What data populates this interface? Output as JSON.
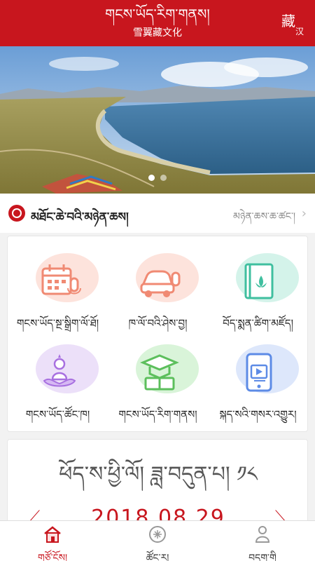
{
  "header": {
    "title_tibetan": "གངས་ཡོད་རིག་གནས།",
    "title_chinese": "雪翼藏文化",
    "lang_primary": "藏",
    "lang_secondary": "汉"
  },
  "banner": {
    "slide_count": 2,
    "active_index": 0
  },
  "news": {
    "title": "མཐོང་ཆེ་བའི་མཉེན་ཆས།",
    "more_label": "མཉེན་ཆས་ཆ་ཚང་།"
  },
  "grid": {
    "items": [
      {
        "label": "གངས་ཡོད་སྔ་སྒྲིག་ལོ་ཐོ།",
        "icon": "calendar-icon",
        "color": "#f5a38f"
      },
      {
        "label": "ཁ་ལོ་བའི་ཤེས་བྱ།",
        "icon": "car-icon",
        "color": "#f5a38f"
      },
      {
        "label": "བོད་སྨན་ཚིག་མཛོད།",
        "icon": "medicine-book-icon",
        "color": "#5fcfb5"
      },
      {
        "label": "གངས་ཡོད་ཚོང་ཁ།",
        "icon": "buddha-lotus-icon",
        "color": "#c39be8"
      },
      {
        "label": "གངས་ཡོད་རིག་གནས།",
        "icon": "graduation-book-icon",
        "color": "#8fd48f"
      },
      {
        "label": "སྐད་སའི་གསར་འགྱུར།",
        "icon": "phone-video-icon",
        "color": "#7fa7ef"
      }
    ]
  },
  "date_card": {
    "tibetan_text": "ཕོད་ས་ཕྱི་ལོ། ཟླ་བདུན་པ། ༡༨",
    "date_text": "2018.08.29"
  },
  "tabs": [
    {
      "label": "གཙོ་ངོས།",
      "icon": "home-icon",
      "active": true
    },
    {
      "label": "ཚོང་ར།",
      "icon": "market-icon",
      "active": false
    },
    {
      "label": "བདག་གི",
      "icon": "user-icon",
      "active": false
    }
  ],
  "colors": {
    "brand": "#c8161e"
  }
}
